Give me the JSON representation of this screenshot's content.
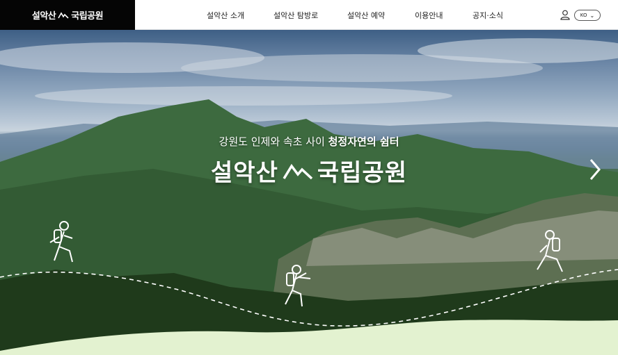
{
  "header": {
    "logo_text_left": "설악산",
    "logo_text_right": "국립공원",
    "nav": [
      "설악산 소개",
      "설악산 탐방로",
      "설악산 예약",
      "이용안내",
      "공지·소식"
    ],
    "lang": "KO"
  },
  "hero": {
    "tagline_plain": "강원도 인제와 속초 사이 ",
    "tagline_bold": "청정자연의 쉼터",
    "title_left": "설악산",
    "title_right": "국립공원"
  },
  "colors": {
    "logo_bg": "#050505",
    "header_bg": "#ffffff",
    "text_dark": "#222222",
    "hero_text": "#ffffff"
  }
}
